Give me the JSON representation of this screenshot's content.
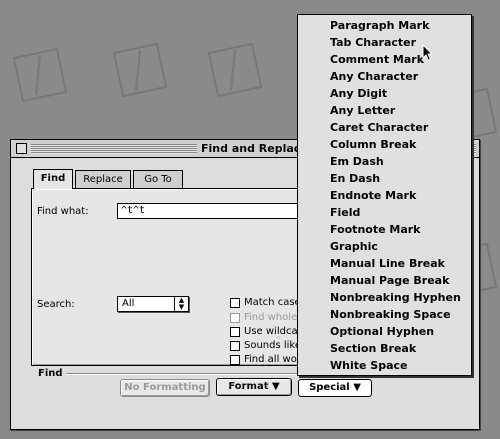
{
  "window": {
    "title": "Find and Replace"
  },
  "tabs": [
    {
      "label": "Find",
      "active": true
    },
    {
      "label": "Replace",
      "active": false
    },
    {
      "label": "Go To",
      "active": false
    }
  ],
  "find_what": {
    "label": "Find what:",
    "value": "^t^t"
  },
  "search": {
    "label": "Search:",
    "value": "All"
  },
  "options": [
    {
      "label": "Match case",
      "checked": false,
      "enabled": true
    },
    {
      "label": "Find whole",
      "checked": false,
      "enabled": false
    },
    {
      "label": "Use wildcar",
      "checked": false,
      "enabled": true
    },
    {
      "label": "Sounds like",
      "checked": false,
      "enabled": true
    },
    {
      "label": "Find all wor",
      "checked": false,
      "enabled": true
    }
  ],
  "find_section": {
    "label": "Find"
  },
  "buttons": {
    "no_formatting": "No Formatting",
    "format": "Format",
    "special": "Special"
  },
  "special_menu": {
    "items": [
      "Paragraph Mark",
      "Tab Character",
      "Comment Mark",
      "Any Character",
      "Any Digit",
      "Any Letter",
      "Caret Character",
      "Column Break",
      "Em Dash",
      "En Dash",
      "Endnote Mark",
      "Field",
      "Footnote Mark",
      "Graphic",
      "Manual Line Break",
      "Manual Page Break",
      "Nonbreaking Hyphen",
      "Nonbreaking Space",
      "Optional Hyphen",
      "Section Break",
      "White Space"
    ]
  },
  "colors": {
    "desktop": "#8a8a8a",
    "window": "#dddddd",
    "menu": "#e0e0e0"
  }
}
